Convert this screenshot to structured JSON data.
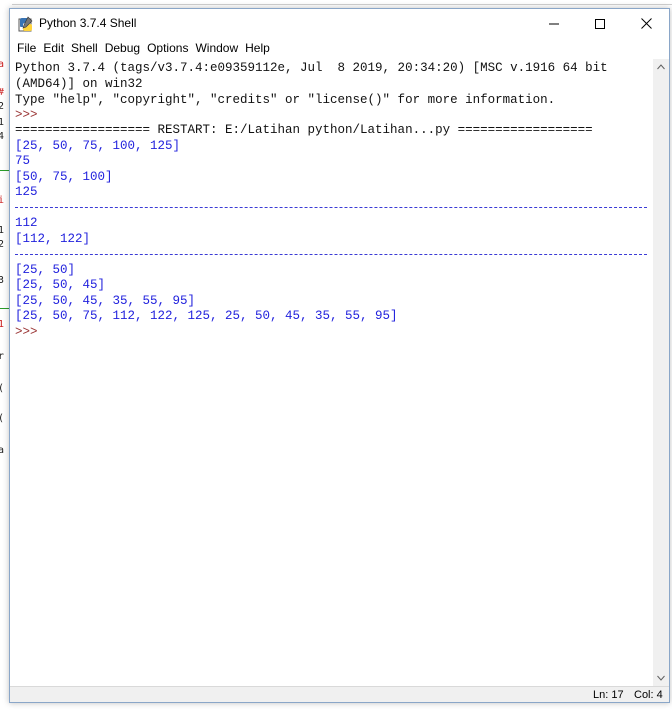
{
  "window": {
    "title": "Python 3.7.4 Shell"
  },
  "menu": [
    "File",
    "Edit",
    "Shell",
    "Debug",
    "Options",
    "Window",
    "Help"
  ],
  "shell": {
    "banner_line1": "Python 3.7.4 (tags/v3.7.4:e09359112e, Jul  8 2019, 20:34:20) [MSC v.1916 64 bit",
    "banner_line2": "(AMD64)] on win32",
    "banner_line3": "Type \"help\", \"copyright\", \"credits\" or \"license()\" for more information.",
    "prompt": ">>>",
    "restart": "================== RESTART: E:/Latihan python/Latihan...py ==================",
    "output": [
      "[25, 50, 75, 100, 125]",
      "75",
      "[50, 75, 100]",
      "125",
      "112",
      "[112, 122]",
      "[25, 50]",
      "[25, 50, 45]",
      "[25, 50, 45, 35, 55, 95]",
      "[25, 50, 75, 112, 122, 125, 25, 50, 45, 35, 55, 95]"
    ]
  },
  "status": {
    "line": "Ln: 17",
    "col": "Col: 4"
  },
  "colors": {
    "output": "#2222dd",
    "prompt": "#9a3434",
    "separator": "#3b3bd6"
  }
}
